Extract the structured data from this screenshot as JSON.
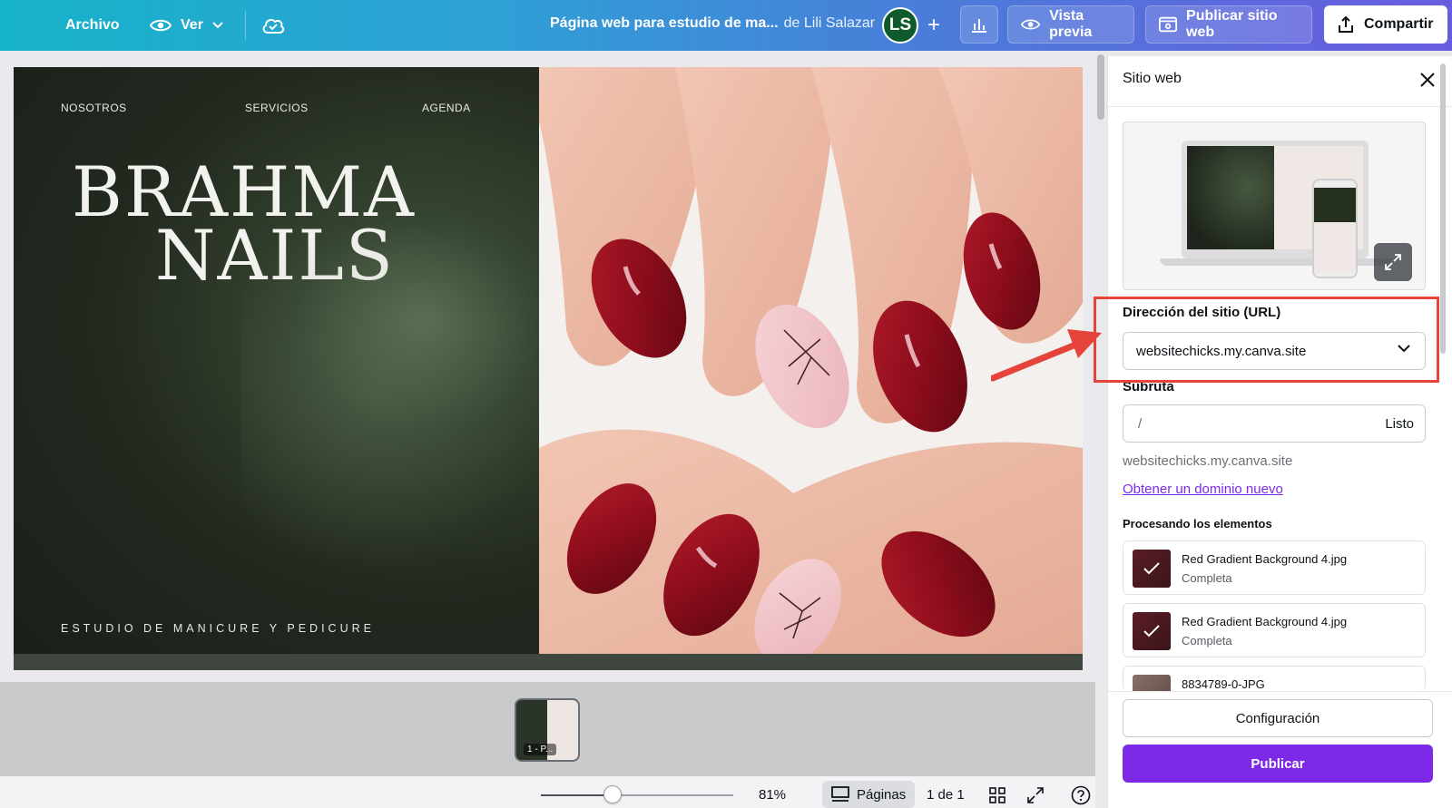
{
  "topbar": {
    "file_label": "Archivo",
    "view_label": "Ver",
    "doc_title": "Página web para estudio de ma...",
    "doc_owner": "de Lili Salazar",
    "avatar_initials": "LS",
    "preview_label": "Vista previa",
    "publish_site_label": "Publicar sitio web",
    "share_label": "Compartir"
  },
  "design": {
    "nav": [
      "NOSOTROS",
      "SERVICIOS",
      "AGENDA"
    ],
    "logo_line1": "BRAHMA",
    "logo_line2": "NAILS",
    "tagline": "ESTUDIO DE MANICURE Y PEDICURE"
  },
  "thumbnail": {
    "label": "1 - P..."
  },
  "bottombar": {
    "zoom_percent": 81,
    "zoom_label": "81%",
    "pages_label": "Páginas",
    "page_count": "1 de 1"
  },
  "panel": {
    "title": "Sitio web",
    "url_section_label": "Dirección del sitio (URL)",
    "url_value": "websitechicks.my.canva.site",
    "subpath_label": "Subruta",
    "subpath_value": "/",
    "subpath_done": "Listo",
    "full_url": "websitechicks.my.canva.site",
    "new_domain_link": "Obtener un dominio nuevo",
    "processing_label": "Procesando los elementos",
    "assets": [
      {
        "name": "Red Gradient Background 4.jpg",
        "status": "Completa"
      },
      {
        "name": "Red Gradient Background 4.jpg",
        "status": "Completa"
      },
      {
        "name": "8834789-0-JPG",
        "status": ""
      }
    ],
    "config_button": "Configuración",
    "publish_button": "Publicar"
  },
  "colors": {
    "accent": "#7d2ae8",
    "highlight": "#e4443a",
    "nail_red": "#8d0d1c"
  }
}
